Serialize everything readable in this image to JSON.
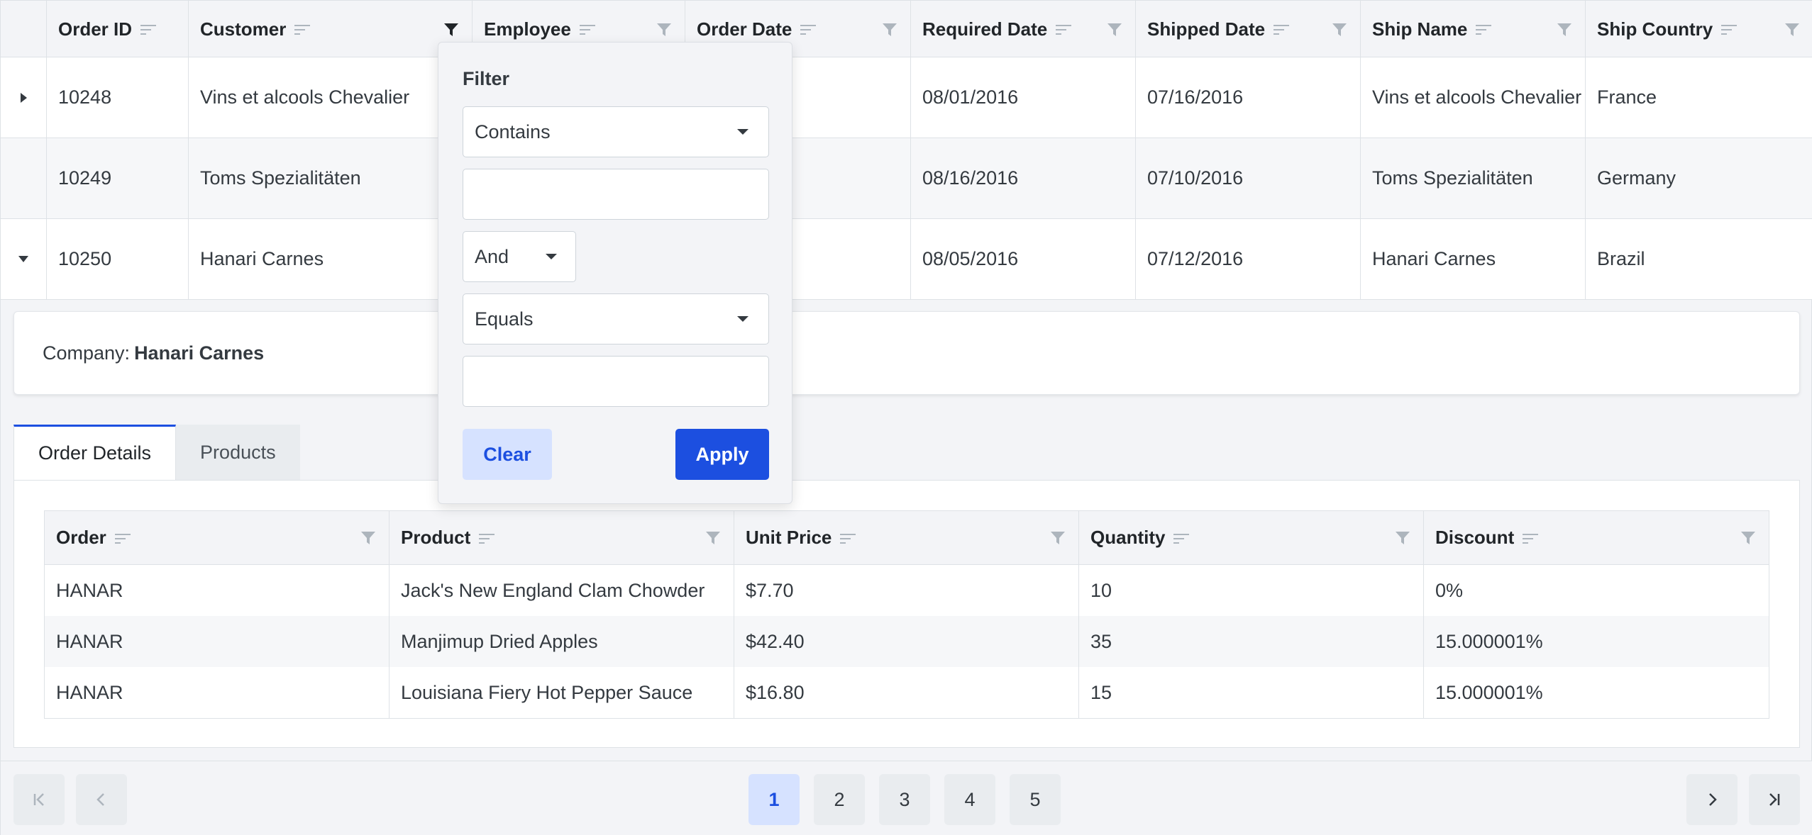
{
  "grid": {
    "columns": [
      {
        "label": "Order ID"
      },
      {
        "label": "Customer"
      },
      {
        "label": "Employee"
      },
      {
        "label": "Order Date"
      },
      {
        "label": "Required Date"
      },
      {
        "label": "Shipped Date"
      },
      {
        "label": "Ship Name"
      },
      {
        "label": "Ship Country"
      }
    ],
    "rows": [
      {
        "id": "10248",
        "customer": "Vins et alcools Chevalier",
        "required": "08/01/2016",
        "shipped": "07/16/2016",
        "ship_name": "Vins et alcools Chevalier",
        "country": "France",
        "expanded": false
      },
      {
        "id": "10249",
        "customer": "Toms Spezialitäten",
        "required": "08/16/2016",
        "shipped": "07/10/2016",
        "ship_name": "Toms Spezialitäten",
        "country": "Germany",
        "expanded": false
      },
      {
        "id": "10250",
        "customer": "Hanari Carnes",
        "required": "08/05/2016",
        "shipped": "07/12/2016",
        "ship_name": "Hanari Carnes",
        "country": "Brazil",
        "expanded": true
      }
    ]
  },
  "detail": {
    "company_label": "Company:",
    "company_value": "Hanari Carnes",
    "tabs": [
      {
        "label": "Order Details",
        "active": true
      },
      {
        "label": "Products",
        "active": false
      }
    ],
    "table": {
      "columns": [
        "Order",
        "Product",
        "Unit Price",
        "Quantity",
        "Discount"
      ],
      "rows": [
        [
          "HANAR",
          "Jack's New England Clam Chowder",
          "$7.70",
          "10",
          "0%"
        ],
        [
          "HANAR",
          "Manjimup Dried Apples",
          "$42.40",
          "35",
          "15.000001%"
        ],
        [
          "HANAR",
          "Louisiana Fiery Hot Pepper Sauce",
          "$16.80",
          "15",
          "15.000001%"
        ]
      ]
    }
  },
  "filter_popup": {
    "title": "Filter",
    "operator1": "Contains",
    "value1": "",
    "logic": "And",
    "operator2": "Equals",
    "value2": "",
    "clear_label": "Clear",
    "apply_label": "Apply"
  },
  "pager": {
    "pages": [
      "1",
      "2",
      "3",
      "4",
      "5"
    ],
    "current": "1"
  },
  "colors": {
    "accent": "#1c4fe0",
    "accent_light": "#d6e2ff",
    "header_bg": "#f3f4f7",
    "border": "#dee2e6"
  }
}
